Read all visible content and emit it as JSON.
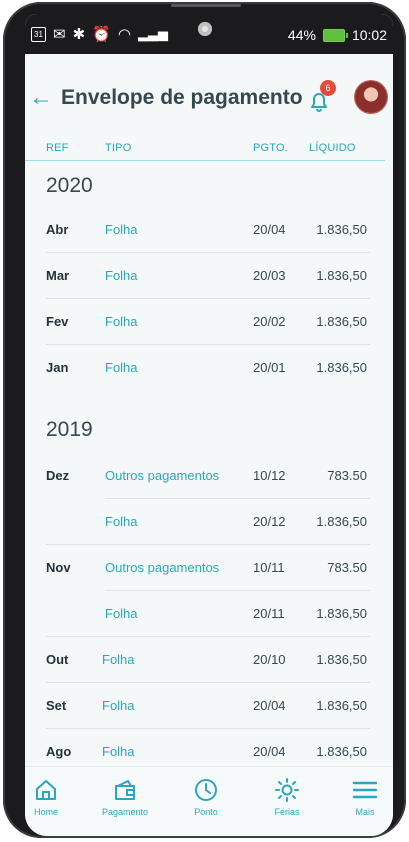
{
  "status_bar": {
    "battery_text": "44%",
    "time": "10:02"
  },
  "header": {
    "title": "Envelope de pagamento",
    "notification_count": "6"
  },
  "columns": {
    "ref": "REF",
    "tipo": "TIPO",
    "pgto": "PGTO.",
    "liquido": "LÍQUIDO"
  },
  "years": [
    {
      "year": "2020",
      "rows": [
        {
          "ref": "Abr",
          "tipo": "Folha",
          "pgto": "20/04",
          "liquido": "1.836,50"
        },
        {
          "ref": "Mar",
          "tipo": "Folha",
          "pgto": "20/03",
          "liquido": "1.836,50"
        },
        {
          "ref": "Fev",
          "tipo": "Folha",
          "pgto": "20/02",
          "liquido": "1.836,50"
        },
        {
          "ref": "Jan",
          "tipo": "Folha",
          "pgto": "20/01",
          "liquido": "1.836,50"
        }
      ]
    },
    {
      "year": "2019",
      "rows": [
        {
          "ref": "Dez",
          "tipo": "Outros pagamentos",
          "pgto": "10/12",
          "liquido": "783.50"
        },
        {
          "ref": "",
          "tipo": "Folha",
          "pgto": "20/12",
          "liquido": "1.836,50"
        },
        {
          "ref": "Nov",
          "tipo": "Outros pagamentos",
          "pgto": "10/11",
          "liquido": "783.50"
        },
        {
          "ref": "",
          "tipo": "Folha",
          "pgto": "20/11",
          "liquido": "1.836,50"
        },
        {
          "ref": "Out",
          "tipo": "Folha",
          "pgto": "20/10",
          "liquido": "1.836,50"
        },
        {
          "ref": "Set",
          "tipo": "Folha",
          "pgto": "20/04",
          "liquido": "1.836,50"
        },
        {
          "ref": "Ago",
          "tipo": "Folha",
          "pgto": "20/04",
          "liquido": "1.836,50"
        }
      ]
    }
  ],
  "bottom_nav": {
    "home": "Home",
    "pagamento": "Pagamento",
    "ponto": "Ponto",
    "ferias": "Férias",
    "mais": "Mais"
  },
  "colors": {
    "accent": "#2aa6bd",
    "badge": "#e54b3c",
    "text": "#37474f",
    "background": "#f4f8f8"
  }
}
